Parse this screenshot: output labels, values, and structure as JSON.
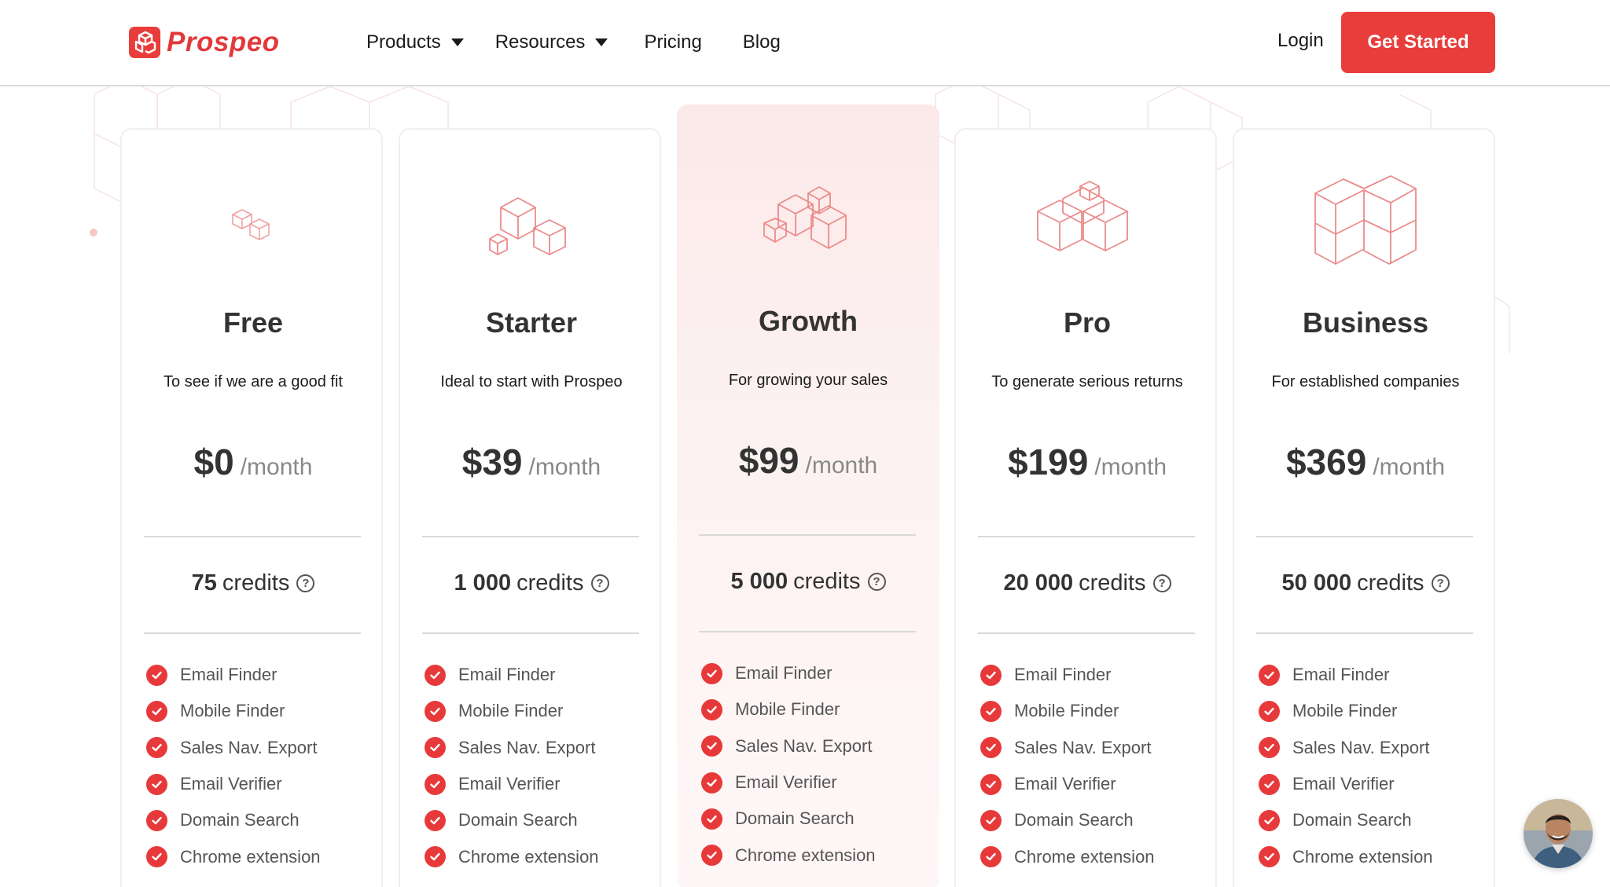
{
  "brand": {
    "name": "Prospeo",
    "accent": "#e83d3b"
  },
  "nav": {
    "products": "Products",
    "resources": "Resources",
    "pricing": "Pricing",
    "blog": "Blog",
    "login": "Login",
    "cta": "Get Started"
  },
  "plans": [
    {
      "name": "Free",
      "description": "To see if we are a good fit",
      "price": "$0",
      "period": "/month",
      "credits_number": "75",
      "credits_label": "credits",
      "icon": "small-cubes-icon"
    },
    {
      "name": "Starter",
      "description": "Ideal to start with Prospeo",
      "price": "$39",
      "period": "/month",
      "credits_number": "1 000",
      "credits_label": "credits",
      "icon": "cubes-icon"
    },
    {
      "name": "Growth",
      "description": "For growing your sales",
      "price": "$99",
      "period": "/month",
      "credits_number": "5 000",
      "credits_label": "credits",
      "icon": "cube-stack-icon",
      "highlighted": true
    },
    {
      "name": "Pro",
      "description": "To generate serious returns",
      "price": "$199",
      "period": "/month",
      "credits_number": "20 000",
      "credits_label": "credits",
      "icon": "cube-pyramid-icon"
    },
    {
      "name": "Business",
      "description": "For established companies",
      "price": "$369",
      "period": "/month",
      "credits_number": "50 000",
      "credits_label": "credits",
      "icon": "cube-block-icon"
    }
  ],
  "features": [
    "Email Finder",
    "Mobile Finder",
    "Sales Nav. Export",
    "Email Verifier",
    "Domain Search",
    "Chrome extension"
  ],
  "help_symbol": "?"
}
